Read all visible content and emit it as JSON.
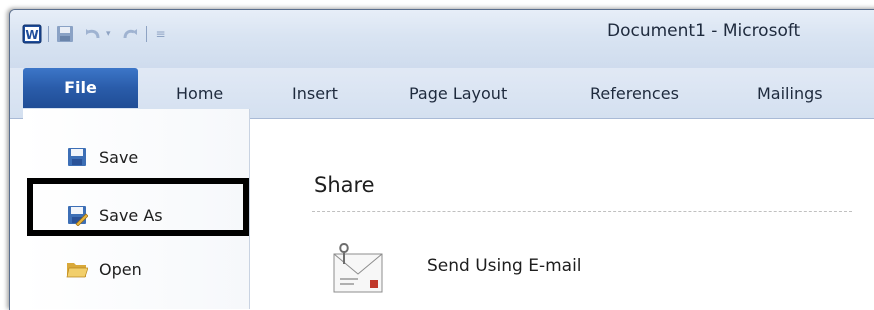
{
  "window": {
    "title": "Document1 - Microsoft"
  },
  "quick_access_toolbar": {
    "icons": [
      "word-app-icon",
      "save-icon",
      "undo-icon",
      "redo-icon",
      "customize-qat-icon"
    ]
  },
  "ribbon": {
    "tabs": [
      {
        "label": "File",
        "active": true
      },
      {
        "label": "Home"
      },
      {
        "label": "Insert"
      },
      {
        "label": "Page Layout"
      },
      {
        "label": "References"
      },
      {
        "label": "Mailings"
      }
    ]
  },
  "backstage": {
    "nav_items": [
      {
        "label": "Save",
        "icon": "save-icon"
      },
      {
        "label": "Save As",
        "icon": "save-as-icon",
        "highlighted": true
      },
      {
        "label": "Open",
        "icon": "open-folder-icon"
      }
    ],
    "share": {
      "heading": "Share",
      "items": [
        {
          "label": "Send Using E-mail",
          "icon": "email-icon"
        }
      ]
    }
  },
  "colors": {
    "file_tab": "#2a5caa",
    "highlight_border": "#000000",
    "title_bar": "#d9e4f2"
  }
}
